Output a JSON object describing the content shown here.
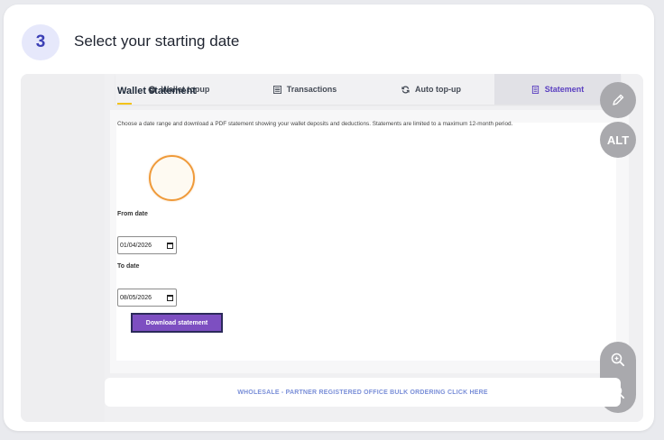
{
  "step": {
    "number": "3",
    "title": "Select your starting date"
  },
  "tabs": [
    {
      "label": "Wallet topup",
      "icon": "plus-circle-icon",
      "active": false
    },
    {
      "label": "Transactions",
      "icon": "list-icon",
      "active": false
    },
    {
      "label": "Auto top-up",
      "icon": "refresh-icon",
      "active": false
    },
    {
      "label": "Statement",
      "icon": "document-icon",
      "active": true
    }
  ],
  "statement": {
    "title": "Wallet statement",
    "description": "Choose a date range and download a PDF statement showing your wallet deposits and deductions. Statements are limited to a maximum 12-month period.",
    "from_label": "From date",
    "from_value": "01/04/2026",
    "to_label": "To date",
    "to_value": "08/05/2026",
    "download_label": "Download statement"
  },
  "footer": {
    "text": "WHOLESALE - PARTNER REGISTERED OFFICE BULK ORDERING CLICK HERE"
  },
  "tools": {
    "alt_label": "ALT"
  },
  "colors": {
    "accent": "#7d4fc1",
    "active_tab_text": "#5a3fc0",
    "highlight": "#ef9a3a",
    "underline": "#f2c21b",
    "link": "#7a8fd8"
  }
}
